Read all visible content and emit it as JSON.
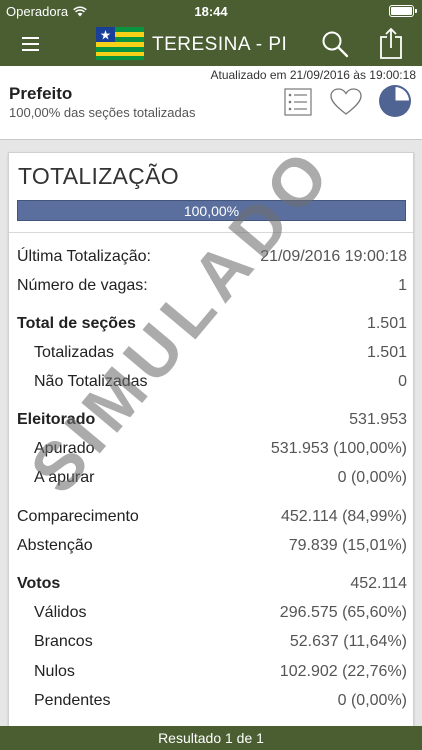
{
  "status_bar": {
    "carrier": "Operadora",
    "time": "18:44"
  },
  "nav": {
    "title": "TERESINA - PI"
  },
  "info": {
    "updated": "Atualizado em 21/09/2016 às 19:00:18",
    "office": "Prefeito",
    "sections_note": "100,00% das seções totalizadas"
  },
  "card": {
    "title": "TOTALIZAÇÃO",
    "progress_label": "100,00%",
    "progress_value": 1.0
  },
  "rows": {
    "last_total": {
      "label": "Última Totalização:",
      "value": "21/09/2016 19:00:18"
    },
    "vacancies": {
      "label": "Número de vagas:",
      "value": "1"
    },
    "sections": {
      "label": "Total de seções",
      "value": "1.501"
    },
    "totalized": {
      "label": "Totalizadas",
      "value": "1.501"
    },
    "not_totalized": {
      "label": "Não Totalizadas",
      "value": "0"
    },
    "electorate": {
      "label": "Eleitorado",
      "value": "531.953"
    },
    "counted": {
      "label": "Apurado",
      "value": "531.953 (100,00%)"
    },
    "to_count": {
      "label": "A apurar",
      "value": "0 (0,00%)"
    },
    "turnout": {
      "label": "Comparecimento",
      "value": "452.114 (84,99%)"
    },
    "abstention": {
      "label": "Abstenção",
      "value": "79.839 (15,01%)"
    },
    "votes": {
      "label": "Votos",
      "value": "452.114"
    },
    "valid": {
      "label": "Válidos",
      "value": "296.575 (65,60%)"
    },
    "blank": {
      "label": "Brancos",
      "value": "52.637 (11,64%)"
    },
    "null": {
      "label": "Nulos",
      "value": "102.902 (22,76%)"
    },
    "pending": {
      "label": "Pendentes",
      "value": "0 (0,00%)"
    }
  },
  "watermark": "SIMULADO",
  "footer": {
    "label": "Resultado 1 de 1"
  },
  "colors": {
    "nav": "#4a5e32",
    "progress": "#5a6f9e",
    "pie": "#4f6492"
  },
  "icons": [
    "wifi-icon",
    "battery-icon",
    "menu-icon",
    "piaui-flag-icon",
    "search-icon",
    "share-icon",
    "list-icon",
    "heart-icon",
    "pie-chart-icon"
  ]
}
